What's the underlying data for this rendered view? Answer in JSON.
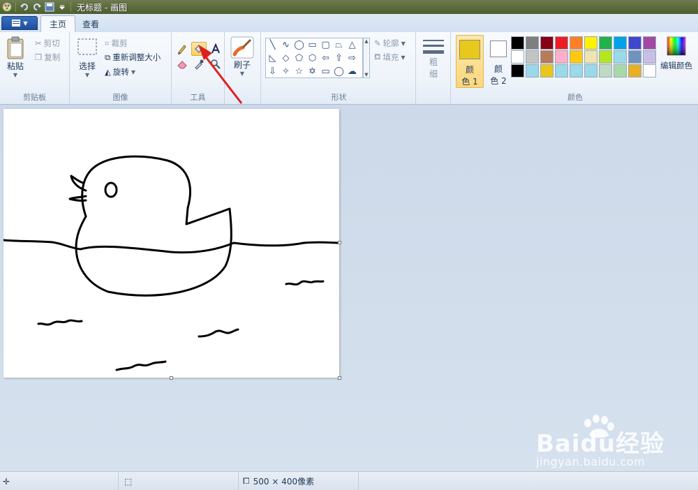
{
  "window": {
    "title": "无标题 - 画图"
  },
  "tabs": [
    {
      "label": "主页",
      "active": true
    },
    {
      "label": "查看",
      "active": false
    }
  ],
  "ribbon": {
    "clipboard": {
      "label": "剪贴板",
      "paste": "粘贴",
      "cut": "剪切",
      "copy": "复制"
    },
    "image": {
      "label": "图像",
      "select": "选择",
      "crop": "裁剪",
      "resize": "重新调整大小",
      "rotate": "旋转"
    },
    "tools": {
      "label": "工具",
      "selected_tool": "fill-icon"
    },
    "brushes": {
      "label": "刷子"
    },
    "shapes": {
      "label": "形状",
      "outline": "轮廓",
      "fill": "填充"
    },
    "size": {
      "line1": "粗",
      "line2": "细"
    },
    "colors": {
      "label": "颜色",
      "color1_line1": "颜",
      "color1_line2": "色 1",
      "color2_line1": "颜",
      "color2_line2": "色 2",
      "color1_value": "#e8c81a",
      "color2_value": "#ffffff",
      "edit": "编辑颜色",
      "palette": [
        "#000000",
        "#7f7f7f",
        "#880015",
        "#ed1c24",
        "#ff7f27",
        "#fff200",
        "#22b14c",
        "#00a2e8",
        "#3f48cc",
        "#a349a4",
        "#ffffff",
        "#c3c3c3",
        "#b97a57",
        "#ffaec9",
        "#ffc90e",
        "#efe4b0",
        "#b5e61d",
        "#99d9ea",
        "#7092be",
        "#c8bfe7",
        "#000000",
        "#99d9ea",
        "#e8c81a",
        "#99d9ea",
        "#99d9ea",
        "#99d9ea",
        "#bfdac0",
        "#a8d8a8",
        "#e8b020",
        "#ffffff"
      ]
    }
  },
  "status": {
    "canvas_size": "500 × 400像素"
  },
  "watermark": {
    "brand": "Baidu经验",
    "url": "jingyan.baidu.com"
  }
}
